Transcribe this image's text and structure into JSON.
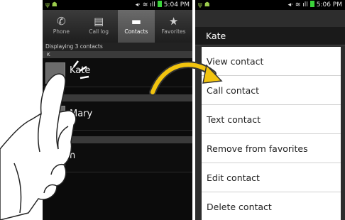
{
  "left_screen": {
    "status_time": "5:04 PM",
    "tabs": [
      {
        "label": "Phone",
        "icon": "phone-icon",
        "glyph": "✆",
        "active": false
      },
      {
        "label": "Call log",
        "icon": "call-log-icon",
        "glyph": "▤",
        "active": false
      },
      {
        "label": "Contacts",
        "icon": "contacts-icon",
        "glyph": "▬",
        "active": true
      },
      {
        "label": "Favorites",
        "icon": "star-icon",
        "glyph": "★",
        "active": false
      }
    ],
    "displaying": "Displaying 3 contacts",
    "sections": [
      "K",
      "M",
      ""
    ],
    "contacts": [
      "Kate",
      "Mary",
      "n"
    ]
  },
  "right_screen": {
    "status_time": "5:06 PM",
    "dialog_title": "Kate",
    "menu_items": [
      "View contact",
      "Call contact",
      "Text contact",
      "Remove from favorites",
      "Edit contact",
      "Delete contact"
    ]
  },
  "colors": {
    "battery": "#3bd23b",
    "arrow": "#f2c40f"
  }
}
